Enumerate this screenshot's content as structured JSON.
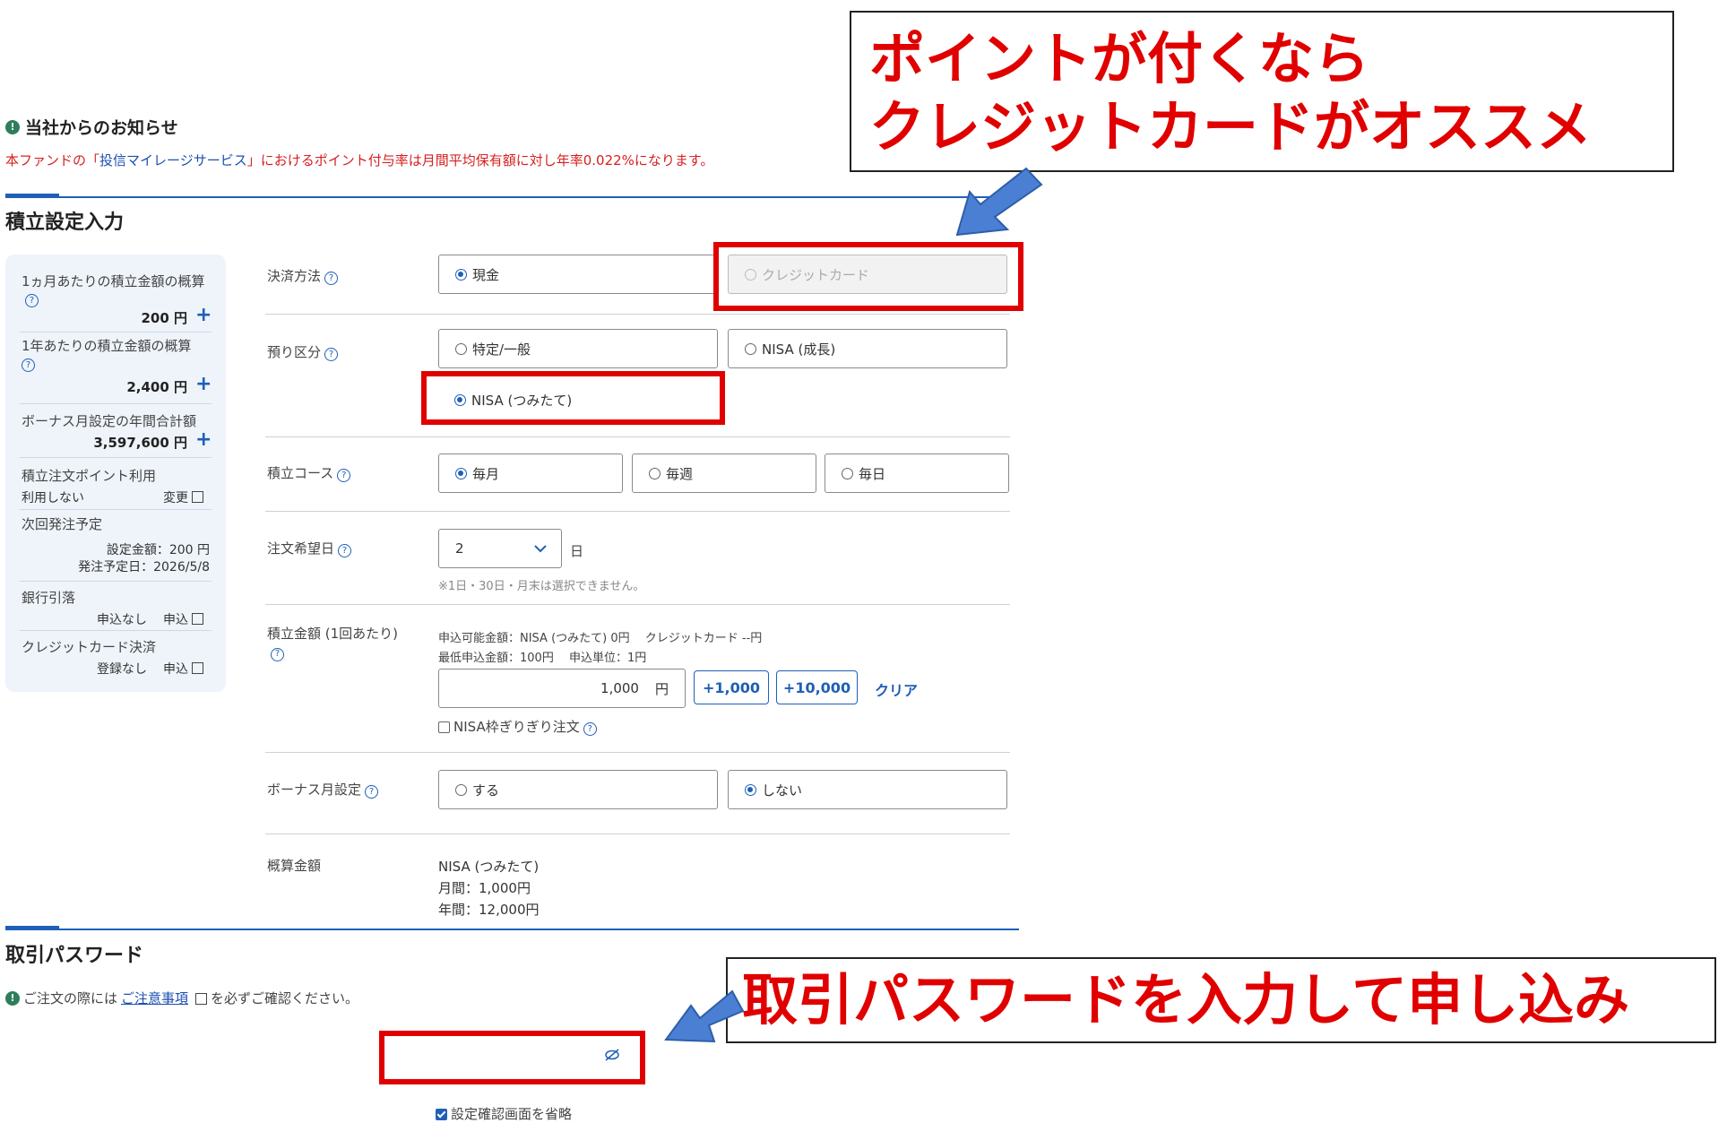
{
  "notice": {
    "heading": "当社からのお知らせ",
    "text_before": "本ファンドの「",
    "text_link": "投信マイレージサービス",
    "text_after": "」におけるポイント付与率は月間平均保有額に対し年率0.022%になります。"
  },
  "section_title": "積立設定入力",
  "sidebar": {
    "monthly_label": "1ヵ月あたりの積立金額の概算",
    "monthly_value": "200 円",
    "yearly_label": "1年あたりの積立金額の概算",
    "yearly_value": "2,400 円",
    "bonus_label": "ボーナス月設定の年間合計額",
    "bonus_value": "3,597,600 円",
    "point_label": "積立注文ポイント利用",
    "point_value": "利用しない",
    "point_link": "変更",
    "next_label": "次回発注予定",
    "next_amount": "設定金額：200 円",
    "next_date": "発注予定日：2026/5/8",
    "bank_label": "銀行引落",
    "bank_status": "申込なし",
    "bank_link": "申込",
    "card_label": "クレジットカード決済",
    "card_status": "登録なし",
    "card_link": "申込"
  },
  "form": {
    "payment": {
      "label": "決済方法",
      "cash": "現金",
      "credit": "クレジットカード"
    },
    "account": {
      "label": "預り区分",
      "tokutei": "特定/一般",
      "nisa_growth": "NISA (成長)",
      "nisa_tsumitate": "NISA (つみたて)"
    },
    "course": {
      "label": "積立コース",
      "monthly": "毎月",
      "weekly": "毎週",
      "daily": "毎日"
    },
    "date": {
      "label": "注文希望日",
      "value": "2",
      "unit": "日",
      "note": "※1日・30日・月末は選択できません。"
    },
    "amount": {
      "label": "積立金額 (1回あたり)",
      "avail": "申込可能金額：NISA (つみたて) 0円　 クレジットカード --円",
      "min": "最低申込金額：100円　 申込単位：1円",
      "value": "1,000",
      "unit": "円",
      "add1": "+1,000",
      "add2": "+10,000",
      "clear": "クリア",
      "nisa_check": "NISA枠ぎりぎり注文"
    },
    "bonus": {
      "label": "ボーナス月設定",
      "yes": "する",
      "no": "しない"
    },
    "estimate": {
      "label": "概算金額",
      "line1": "NISA (つみたて)",
      "line2": "月間：1,000円",
      "line3": "年間：12,000円"
    }
  },
  "password": {
    "title": "取引パスワード",
    "note_before": "ご注文の際には",
    "note_link": "ご注意事項",
    "note_after": "を必ずご確認ください。",
    "skip_label": "設定確認画面を省略"
  },
  "callouts": {
    "top_line1": "ポイントが付くなら",
    "top_line2": "クレジットカードがオススメ",
    "bottom": "取引パスワードを入力して申し込み"
  },
  "colors": {
    "accent": "#1f5fb8",
    "highlight": "#e00000",
    "notice": "#d62020",
    "arrow": "#4a7fd4"
  }
}
